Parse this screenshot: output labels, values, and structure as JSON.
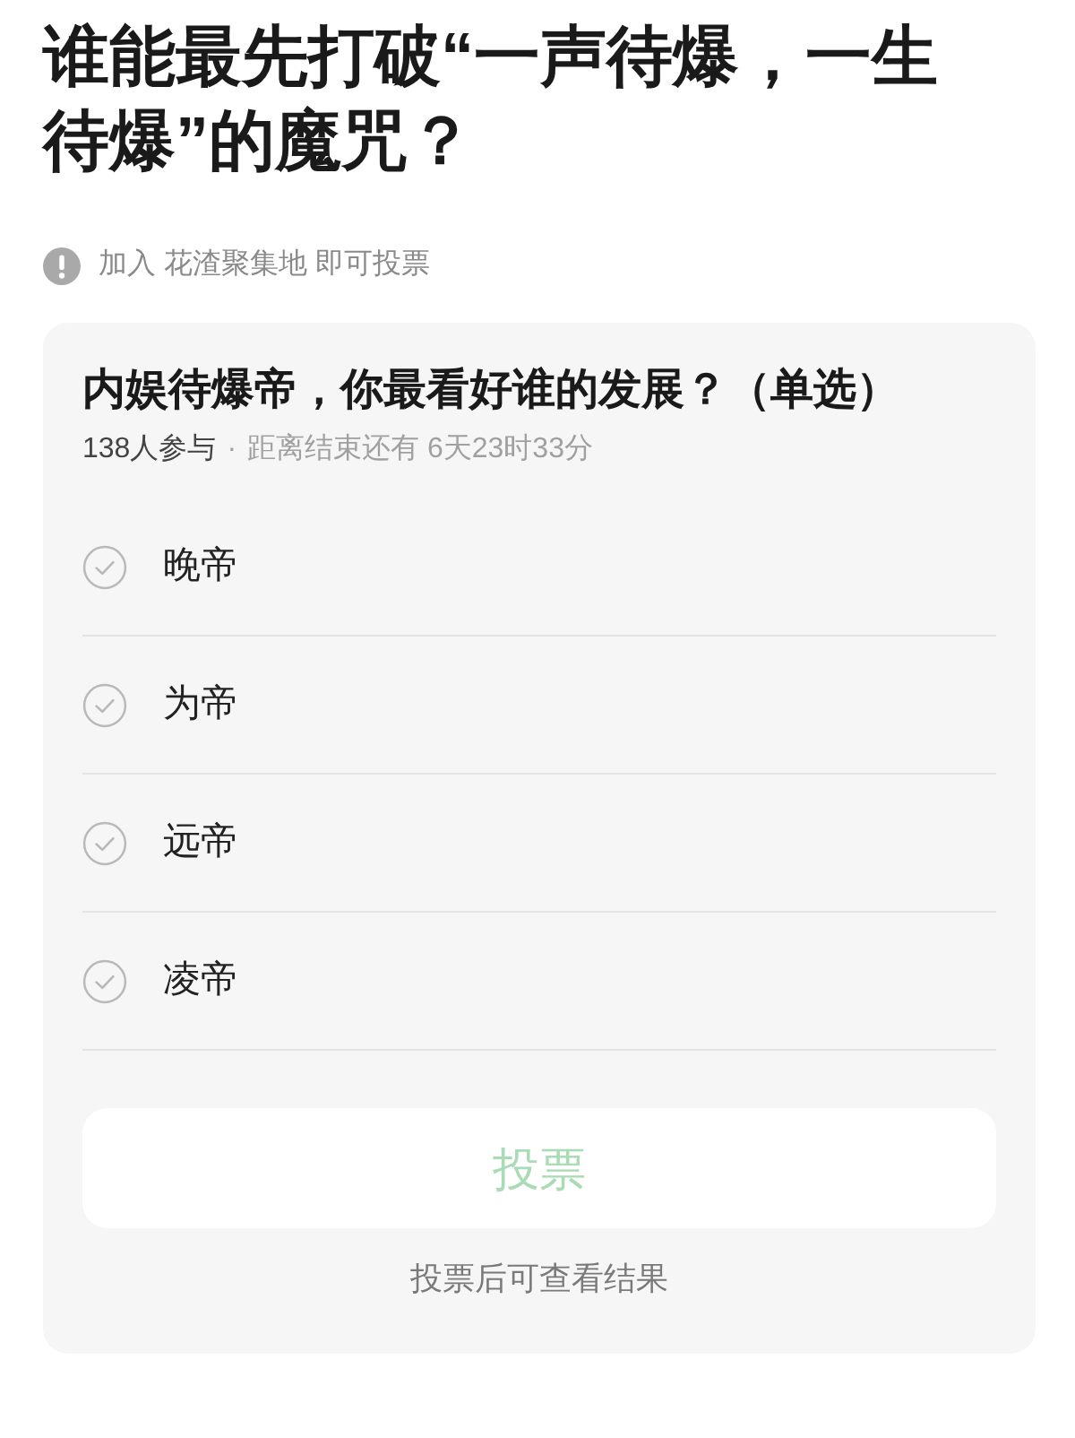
{
  "title": "谁能最先打破“一声待爆，一生待爆”的魔咒？",
  "notice": {
    "text": "加入 花渣聚集地 即可投票"
  },
  "poll": {
    "question": "内娱待爆帝，你最看好谁的发展？（单选）",
    "participants": "138人参与",
    "separator": "·",
    "deadline": "距离结束还有 6天23时33分",
    "options": [
      {
        "label": "晚帝",
        "selected": false
      },
      {
        "label": "为帝",
        "selected": false
      },
      {
        "label": "远帝",
        "selected": false
      },
      {
        "label": "凌帝",
        "selected": false
      }
    ],
    "vote_button": {
      "label": "投票",
      "disabled": true
    },
    "footer": "投票后可查看结果"
  }
}
